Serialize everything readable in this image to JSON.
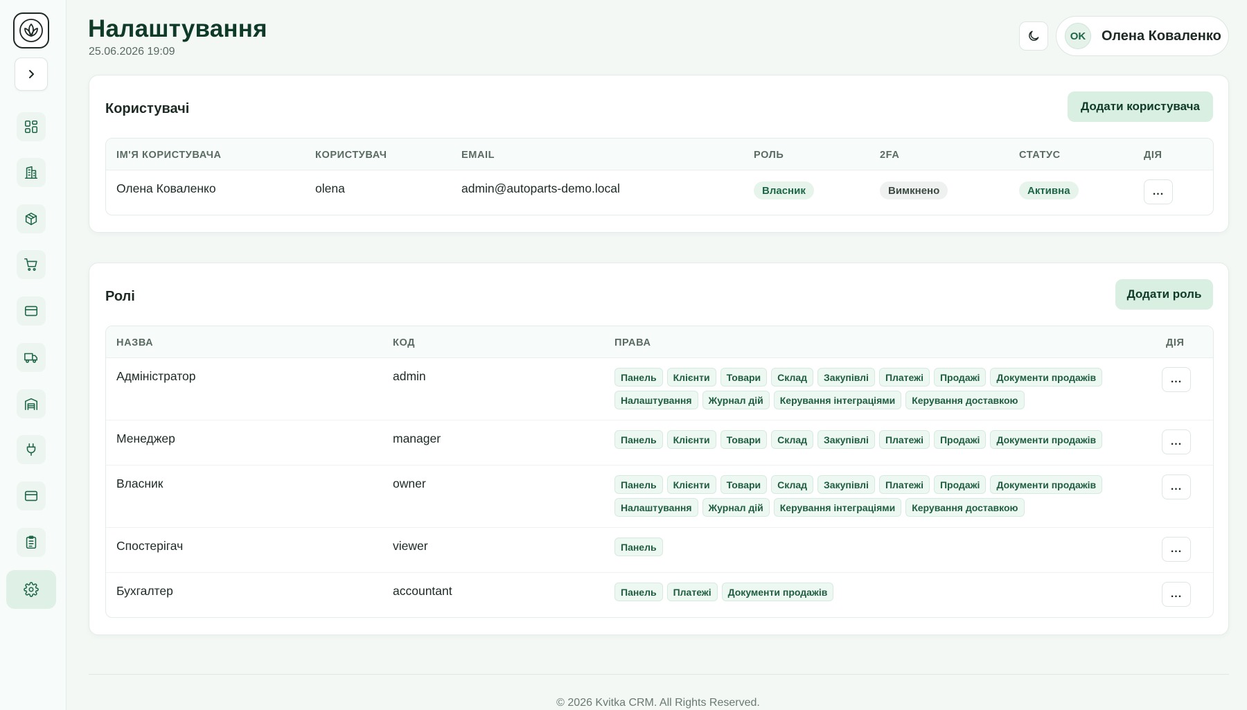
{
  "header": {
    "title": "Налаштування",
    "date": "25.06.2026 19:09",
    "user_initials": "OK",
    "user_name": "Олена Коваленко"
  },
  "sidebar": {
    "items": [
      {
        "name": "dashboard",
        "icon": "grid-icon"
      },
      {
        "name": "companies",
        "icon": "building-icon"
      },
      {
        "name": "products",
        "icon": "box-icon"
      },
      {
        "name": "purchases",
        "icon": "cart-icon"
      },
      {
        "name": "payments",
        "icon": "card-icon"
      },
      {
        "name": "delivery",
        "icon": "truck-icon"
      },
      {
        "name": "warehouse",
        "icon": "warehouse-icon"
      },
      {
        "name": "integrations",
        "icon": "plug-icon"
      },
      {
        "name": "billing",
        "icon": "card-icon"
      },
      {
        "name": "logs",
        "icon": "clipboard-icon"
      },
      {
        "name": "settings",
        "icon": "gear-icon",
        "active": true
      }
    ]
  },
  "users": {
    "title": "Користувачі",
    "add_label": "Додати користувача",
    "columns": {
      "full_name": "Ім'я користувача",
      "username": "Користувач",
      "email": "Email",
      "role": "Роль",
      "twofa": "2FA",
      "status": "Статус",
      "action": "Дія"
    },
    "rows": [
      {
        "full_name": "Олена Коваленко",
        "username": "olena",
        "email": "admin@autoparts-demo.local",
        "role": "Власник",
        "twofa": "Вимкнено",
        "status": "Активна"
      }
    ]
  },
  "roles": {
    "title": "Ролі",
    "add_label": "Додати роль",
    "columns": {
      "name": "Назва",
      "code": "Код",
      "perms": "Права",
      "action": "Дія"
    },
    "rows": [
      {
        "name": "Адміністратор",
        "code": "admin",
        "perms": [
          "Панель",
          "Клієнти",
          "Товари",
          "Склад",
          "Закупівлі",
          "Платежі",
          "Продажі",
          "Документи продажів",
          "Налаштування",
          "Журнал дій",
          "Керування інтеграціями",
          "Керування доставкою"
        ]
      },
      {
        "name": "Менеджер",
        "code": "manager",
        "perms": [
          "Панель",
          "Клієнти",
          "Товари",
          "Склад",
          "Закупівлі",
          "Платежі",
          "Продажі",
          "Документи продажів"
        ]
      },
      {
        "name": "Власник",
        "code": "owner",
        "perms": [
          "Панель",
          "Клієнти",
          "Товари",
          "Склад",
          "Закупівлі",
          "Платежі",
          "Продажі",
          "Документи продажів",
          "Налаштування",
          "Журнал дій",
          "Керування інтеграціями",
          "Керування доставкою"
        ]
      },
      {
        "name": "Спостерігач",
        "code": "viewer",
        "perms": [
          "Панель"
        ]
      },
      {
        "name": "Бухгалтер",
        "code": "accountant",
        "perms": [
          "Панель",
          "Платежі",
          "Документи продажів"
        ]
      }
    ]
  },
  "action_dots": "...",
  "footer": "© 2026 Kvitka CRM. All Rights Reserved.",
  "colors": {
    "accent": "#1e6647",
    "accent_light": "#d8efe2",
    "background": "#f3f8f5"
  }
}
